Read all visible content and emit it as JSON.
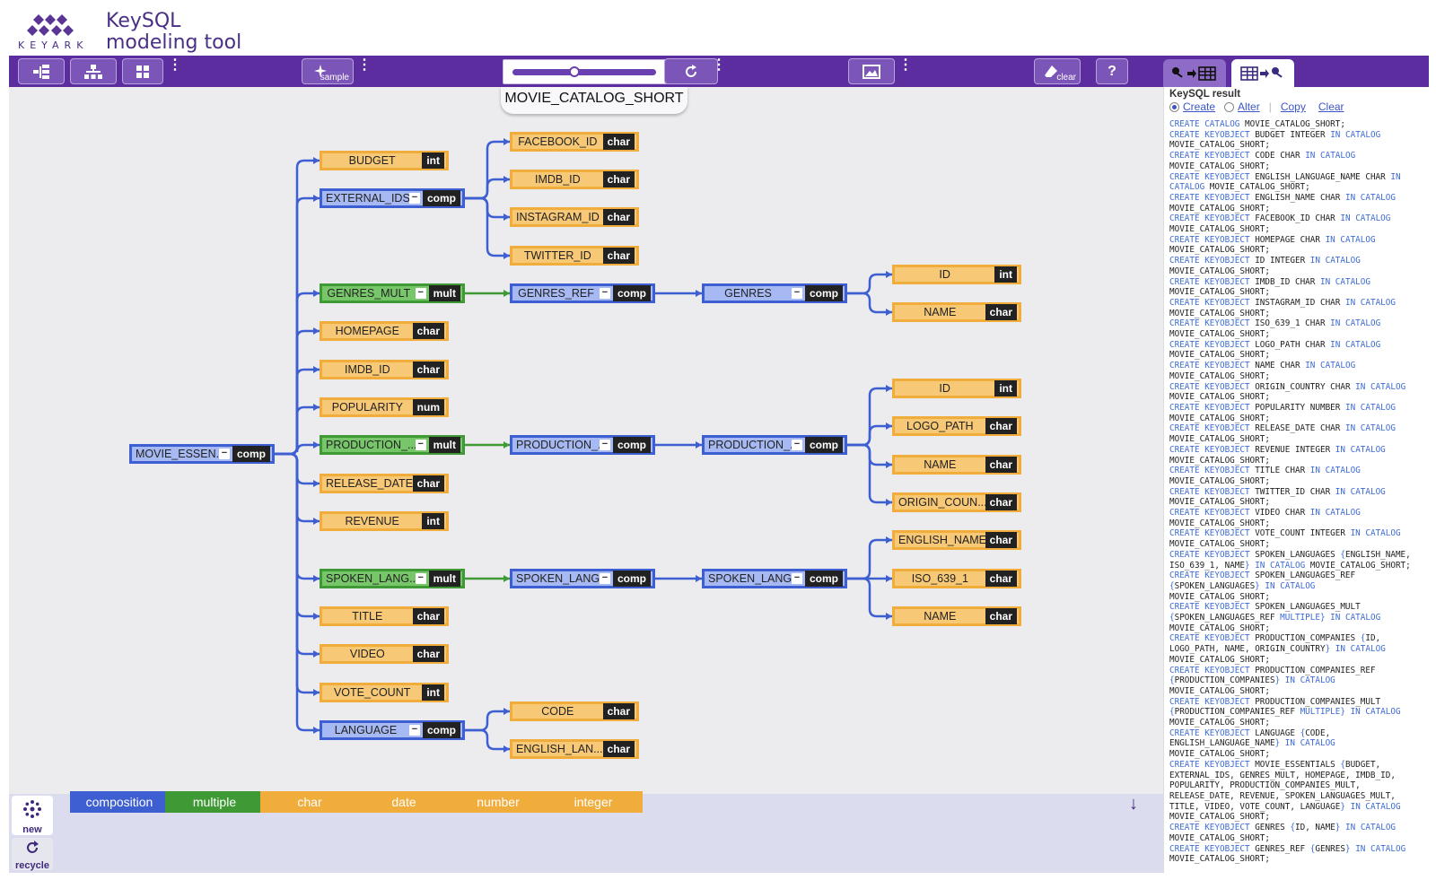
{
  "app": {
    "logo_text": "KEYARK",
    "title_line1": "KeySQL",
    "title_line2": "modeling tool"
  },
  "toolbar": {
    "sample_label": "sample",
    "clear_label": "clear",
    "help_label": "?",
    "zoom_level": 0.43
  },
  "catalog": {
    "name": "MOVIE_CATALOG_SHORT"
  },
  "nodes": [
    {
      "id": "movie",
      "label": "MOVIE_ESSEN...",
      "type": "comp",
      "tag": "comp"
    },
    {
      "id": "budget",
      "label": "BUDGET",
      "type": "leaf",
      "tag": "int"
    },
    {
      "id": "external_ids",
      "label": "EXTERNAL_IDS",
      "type": "comp",
      "tag": "comp"
    },
    {
      "id": "genres_mult",
      "label": "GENRES_MULT",
      "type": "mult",
      "tag": "mult"
    },
    {
      "id": "homepage",
      "label": "HOMEPAGE",
      "type": "leaf",
      "tag": "char"
    },
    {
      "id": "imdb_id",
      "label": "IMDB_ID",
      "type": "leaf",
      "tag": "char"
    },
    {
      "id": "popularity",
      "label": "POPULARITY",
      "type": "leaf",
      "tag": "num"
    },
    {
      "id": "production_mult",
      "label": "PRODUCTION_...",
      "type": "mult",
      "tag": "mult"
    },
    {
      "id": "release_date",
      "label": "RELEASE_DATE",
      "type": "leaf",
      "tag": "char"
    },
    {
      "id": "revenue",
      "label": "REVENUE",
      "type": "leaf",
      "tag": "int"
    },
    {
      "id": "spoken_mult",
      "label": "SPOKEN_LANG...",
      "type": "mult",
      "tag": "mult"
    },
    {
      "id": "title",
      "label": "TITLE",
      "type": "leaf",
      "tag": "char"
    },
    {
      "id": "video",
      "label": "VIDEO",
      "type": "leaf",
      "tag": "char"
    },
    {
      "id": "vote_count",
      "label": "VOTE_COUNT",
      "type": "leaf",
      "tag": "int"
    },
    {
      "id": "language",
      "label": "LANGUAGE",
      "type": "comp",
      "tag": "comp"
    },
    {
      "id": "facebook_id",
      "label": "FACEBOOK_ID",
      "type": "leaf",
      "tag": "char"
    },
    {
      "id": "ext_imdb_id",
      "label": "IMDB_ID",
      "type": "leaf",
      "tag": "char"
    },
    {
      "id": "instagram_id",
      "label": "INSTAGRAM_ID",
      "type": "leaf",
      "tag": "char"
    },
    {
      "id": "twitter_id",
      "label": "TWITTER_ID",
      "type": "leaf",
      "tag": "char"
    },
    {
      "id": "genres_ref",
      "label": "GENRES_REF",
      "type": "comp",
      "tag": "comp"
    },
    {
      "id": "production_ref",
      "label": "PRODUCTION_...",
      "type": "comp",
      "tag": "comp"
    },
    {
      "id": "spoken_ref",
      "label": "SPOKEN_LANG...",
      "type": "comp",
      "tag": "comp"
    },
    {
      "id": "code",
      "label": "CODE",
      "type": "leaf",
      "tag": "char"
    },
    {
      "id": "english_lang",
      "label": "ENGLISH_LAN...",
      "type": "leaf",
      "tag": "char"
    },
    {
      "id": "genres",
      "label": "GENRES",
      "type": "comp",
      "tag": "comp"
    },
    {
      "id": "production",
      "label": "PRODUCTION_...",
      "type": "comp",
      "tag": "comp"
    },
    {
      "id": "spoken",
      "label": "SPOKEN_LANG...",
      "type": "comp",
      "tag": "comp"
    },
    {
      "id": "genre_id",
      "label": "ID",
      "type": "leaf",
      "tag": "int"
    },
    {
      "id": "genre_name",
      "label": "NAME",
      "type": "leaf",
      "tag": "char"
    },
    {
      "id": "prod_id",
      "label": "ID",
      "type": "leaf",
      "tag": "int"
    },
    {
      "id": "logo_path",
      "label": "LOGO_PATH",
      "type": "leaf",
      "tag": "char"
    },
    {
      "id": "prod_name",
      "label": "NAME",
      "type": "leaf",
      "tag": "char"
    },
    {
      "id": "origin_country",
      "label": "ORIGIN_COUN...",
      "type": "leaf",
      "tag": "char"
    },
    {
      "id": "english_name",
      "label": "ENGLISH_NAME",
      "type": "leaf",
      "tag": "char"
    },
    {
      "id": "iso_639_1",
      "label": "ISO_639_1",
      "type": "leaf",
      "tag": "char"
    },
    {
      "id": "spoken_name",
      "label": "NAME",
      "type": "leaf",
      "tag": "char"
    }
  ],
  "legend": {
    "new_label": "new",
    "recycle_label": "recycle",
    "items": [
      {
        "label": "composition",
        "color": "#3e5fd2"
      },
      {
        "label": "multiple",
        "color": "#3f9a36"
      },
      {
        "label": "char",
        "color": "#f0ad3c"
      },
      {
        "label": "date",
        "color": "#f0ad3c"
      },
      {
        "label": "number",
        "color": "#f0ad3c"
      },
      {
        "label": "integer",
        "color": "#f0ad3c"
      }
    ]
  },
  "result": {
    "title": "KeySQL result",
    "create_label": "Create",
    "alter_label": "Alter",
    "copy_label": "Copy",
    "clear_label": "Clear",
    "selected_mode": "Create",
    "lines": [
      "CREATE CATALOG MOVIE_CATALOG_SHORT;",
      "CREATE KEYOBJECT BUDGET INTEGER IN CATALOG",
      "MOVIE_CATALOG_SHORT;",
      "CREATE KEYOBJECT CODE CHAR IN CATALOG",
      "MOVIE_CATALOG_SHORT;",
      "CREATE KEYOBJECT ENGLISH_LANGUAGE_NAME CHAR IN",
      "CATALOG MOVIE_CATALOG_SHORT;",
      "CREATE KEYOBJECT ENGLISH_NAME CHAR IN CATALOG",
      "MOVIE_CATALOG_SHORT;",
      "CREATE KEYOBJECT FACEBOOK_ID CHAR IN CATALOG",
      "MOVIE_CATALOG_SHORT;",
      "CREATE KEYOBJECT HOMEPAGE CHAR IN CATALOG",
      "MOVIE_CATALOG_SHORT;",
      "CREATE KEYOBJECT ID INTEGER IN CATALOG",
      "MOVIE_CATALOG_SHORT;",
      "CREATE KEYOBJECT IMDB_ID CHAR IN CATALOG",
      "MOVIE_CATALOG_SHORT;",
      "CREATE KEYOBJECT INSTAGRAM_ID CHAR IN CATALOG",
      "MOVIE_CATALOG_SHORT;",
      "CREATE KEYOBJECT ISO_639_1 CHAR IN CATALOG",
      "MOVIE_CATALOG_SHORT;",
      "CREATE KEYOBJECT LOGO_PATH CHAR IN CATALOG",
      "MOVIE_CATALOG_SHORT;",
      "CREATE KEYOBJECT NAME CHAR IN CATALOG",
      "MOVIE_CATALOG_SHORT;",
      "CREATE KEYOBJECT ORIGIN_COUNTRY CHAR IN CATALOG",
      "MOVIE_CATALOG_SHORT;",
      "CREATE KEYOBJECT POPULARITY NUMBER IN CATALOG",
      "MOVIE_CATALOG_SHORT;",
      "CREATE KEYOBJECT RELEASE_DATE CHAR IN CATALOG",
      "MOVIE_CATALOG_SHORT;",
      "CREATE KEYOBJECT REVENUE INTEGER IN CATALOG",
      "MOVIE_CATALOG_SHORT;",
      "CREATE KEYOBJECT TITLE CHAR IN CATALOG",
      "MOVIE_CATALOG_SHORT;",
      "CREATE KEYOBJECT TWITTER_ID CHAR IN CATALOG",
      "MOVIE_CATALOG_SHORT;",
      "CREATE KEYOBJECT VIDEO CHAR IN CATALOG",
      "MOVIE_CATALOG_SHORT;",
      "CREATE KEYOBJECT VOTE_COUNT INTEGER IN CATALOG",
      "MOVIE_CATALOG_SHORT;",
      "CREATE KEYOBJECT SPOKEN_LANGUAGES {ENGLISH_NAME,",
      "ISO_639_1, NAME} IN CATALOG MOVIE_CATALOG_SHORT;",
      "CREATE KEYOBJECT SPOKEN_LANGUAGES_REF",
      "{SPOKEN_LANGUAGES} IN CATALOG",
      "MOVIE_CATALOG_SHORT;",
      "CREATE KEYOBJECT SPOKEN_LANGUAGES_MULT",
      "{SPOKEN_LANGUAGES_REF MULTIPLE} IN CATALOG",
      "MOVIE_CATALOG_SHORT;",
      "CREATE KEYOBJECT PRODUCTION_COMPANIES {ID,",
      "LOGO_PATH, NAME, ORIGIN_COUNTRY} IN CATALOG",
      "MOVIE_CATALOG_SHORT;",
      "CREATE KEYOBJECT PRODUCTION_COMPANIES_REF",
      "{PRODUCTION_COMPANIES} IN CATALOG",
      "MOVIE_CATALOG_SHORT;",
      "CREATE KEYOBJECT PRODUCTION_COMPANIES_MULT",
      "{PRODUCTION_COMPANIES_REF MULTIPLE} IN CATALOG",
      "MOVIE_CATALOG_SHORT;",
      "CREATE KEYOBJECT LANGUAGE {CODE,",
      "ENGLISH_LANGUAGE_NAME} IN CATALOG",
      "MOVIE_CATALOG_SHORT;",
      "CREATE KEYOBJECT MOVIE_ESSENTIALS {BUDGET,",
      "EXTERNAL_IDS, GENRES_MULT, HOMEPAGE, IMDB_ID,",
      "POPULARITY, PRODUCTION_COMPANIES_MULT,",
      "RELEASE_DATE, REVENUE, SPOKEN_LANGUAGES_MULT,",
      "TITLE, VIDEO, VOTE_COUNT, LANGUAGE} IN CATALOG",
      "MOVIE_CATALOG_SHORT;",
      "CREATE KEYOBJECT GENRES {ID, NAME} IN CATALOG",
      "MOVIE_CATALOG_SHORT;",
      "CREATE KEYOBJECT GENRES_REF {GENRES} IN CATALOG",
      "MOVIE_CATALOG_SHORT;"
    ]
  }
}
